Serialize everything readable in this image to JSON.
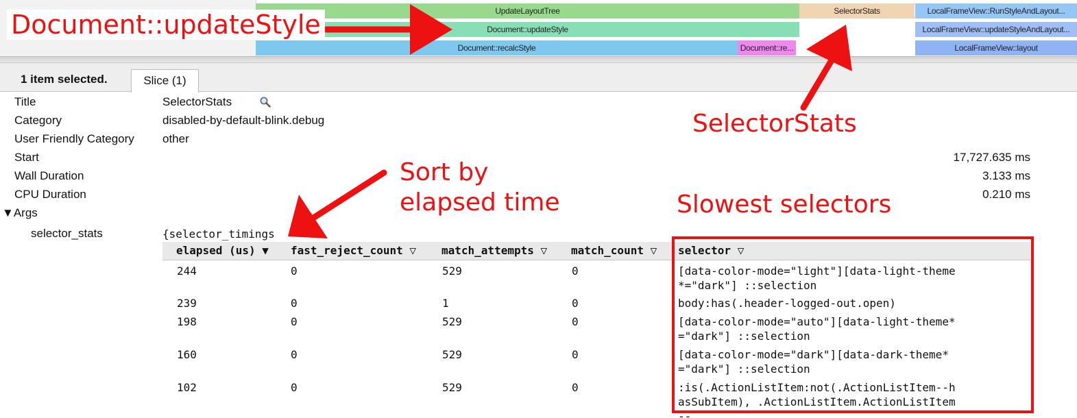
{
  "flame": {
    "slices": [
      {
        "name": "UpdateLayoutTree",
        "color": "#98d98e"
      },
      {
        "name": "Document::updateStyle",
        "color": "#88dfb6"
      },
      {
        "name": "Document::recalcStyle",
        "color": "#7ec7ef"
      },
      {
        "name": "Document::re...",
        "color": "#ee88ee"
      },
      {
        "name": "SelectorStats",
        "color": "#f1d4b4"
      },
      {
        "name": "LocalFrameView::RunStyleAndLayout...",
        "color": "#96c6f6"
      },
      {
        "name": "LocalFrameView::updateStyleAndLayout...",
        "color": "#9fbff6"
      },
      {
        "name": "LocalFrameView::layout",
        "color": "#8fb3f4"
      }
    ]
  },
  "selection": {
    "summary": "1 item selected.",
    "tab": "Slice (1)"
  },
  "properties": {
    "title_label": "Title",
    "title_value": "SelectorStats",
    "category_label": "Category",
    "category_value": "disabled-by-default-blink.debug",
    "friendly_label": "User Friendly Category",
    "friendly_value": "other",
    "start_label": "Start",
    "start_value": "17,727.635 ms",
    "wall_label": "Wall Duration",
    "wall_value": "3.133 ms",
    "cpu_label": "CPU Duration",
    "cpu_value": "0.210 ms",
    "args_label": "▼Args",
    "stats_label": "selector_stats",
    "stats_prefix": "{selector_timings"
  },
  "table": {
    "headers": {
      "elapsed": "elapsed (us) ▼",
      "fast_reject": "fast_reject_count ▽",
      "attempts": "match_attempts ▽",
      "count": "match_count ▽",
      "selector": "selector ▽"
    },
    "rows": [
      {
        "elapsed": "244",
        "fast_reject": "0",
        "attempts": "529",
        "count": "0",
        "selector": "[data-color-mode=\"light\"][data-light-theme*=\"dark\"] ::selection"
      },
      {
        "elapsed": "239",
        "fast_reject": "0",
        "attempts": "1",
        "count": "0",
        "selector": "body:has(.header-logged-out.open)"
      },
      {
        "elapsed": "198",
        "fast_reject": "0",
        "attempts": "529",
        "count": "0",
        "selector": "[data-color-mode=\"auto\"][data-light-theme*=\"dark\"] ::selection"
      },
      {
        "elapsed": "160",
        "fast_reject": "0",
        "attempts": "529",
        "count": "0",
        "selector": "[data-color-mode=\"dark\"][data-dark-theme*=\"dark\"] ::selection"
      },
      {
        "elapsed": "102",
        "fast_reject": "0",
        "attempts": "529",
        "count": "0",
        "selector": ":is(.ActionListItem:not(.ActionListItem--hasSubItem), .ActionListItem.ActionListItem--"
      }
    ]
  },
  "annotations": {
    "document_update_style": "Document::updateStyle",
    "selector_stats": "SelectorStats",
    "sort_line1": "Sort by",
    "sort_line2": "elapsed time",
    "slowest": "Slowest selectors",
    "color": "#ee1111"
  }
}
